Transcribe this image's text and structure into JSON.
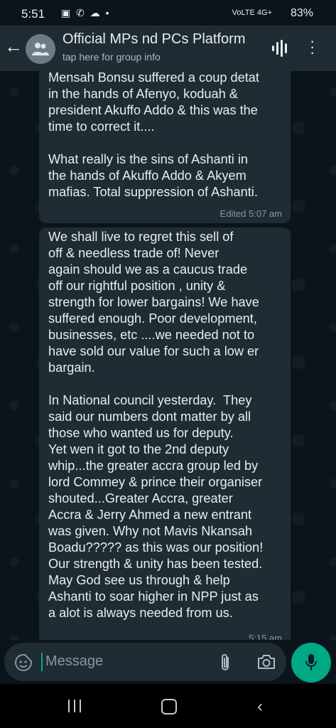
{
  "status_bar": {
    "time": "5:51",
    "notif_icons": "▣ ✆ ☁ •",
    "signal_text": "VoLTE 4G+",
    "battery": "83%"
  },
  "header": {
    "title": "Official MPs nd PCs Platform",
    "subtitle": "tap here for group info"
  },
  "messages": [
    {
      "text": "Mensah Bonsu suffered a coup detat\nin the hands of Afenyo, koduah &\npresident Akuffo Addo & this was the\ntime to correct it....\n\nWhat really is the sins of Ashanti in\nthe hands of Akuffo Addo & Akyem\nmafias. Total suppression of Ashanti.",
      "meta": "Edited  5:07 am"
    },
    {
      "text": "We shall live to regret this sell of\noff & needless trade of! Never\nagain should we as a caucus trade\noff our rightful position , unity &\nstrength for lower bargains! We have\nsuffered enough. Poor development,\nbusinesses, etc ....we needed not to\nhave sold our value for such a low er\nbargain.\n\nIn National council yesterday.  They\nsaid our numbers dont matter by all\nthose who wanted us for deputy.\nYet wen it got to the 2nd deputy\nwhip...the greater accra group led by\nlord Commey & prince their organiser\nshouted...Greater Accra, greater\nAccra & Jerry Ahmed a new entrant\nwas given. Why not Mavis Nkansah\nBoadu????? as this was our position!\nOur strength & unity has been tested.\nMay God see us through & help\nAshanti to soar higher in NPP just as\na alot is always needed from us.",
      "meta": "5:15 am"
    }
  ],
  "input": {
    "placeholder": "Message"
  },
  "colors": {
    "background": "#0b141a",
    "bubble": "#1f2c34",
    "accent": "#00a884"
  },
  "icons": [
    "back-arrow-icon",
    "group-avatar-icon",
    "voice-chat-icon",
    "more-options-icon",
    "sticker-icon",
    "attach-icon",
    "camera-icon",
    "mic-icon",
    "recent-apps-icon",
    "home-icon",
    "nav-back-icon"
  ]
}
